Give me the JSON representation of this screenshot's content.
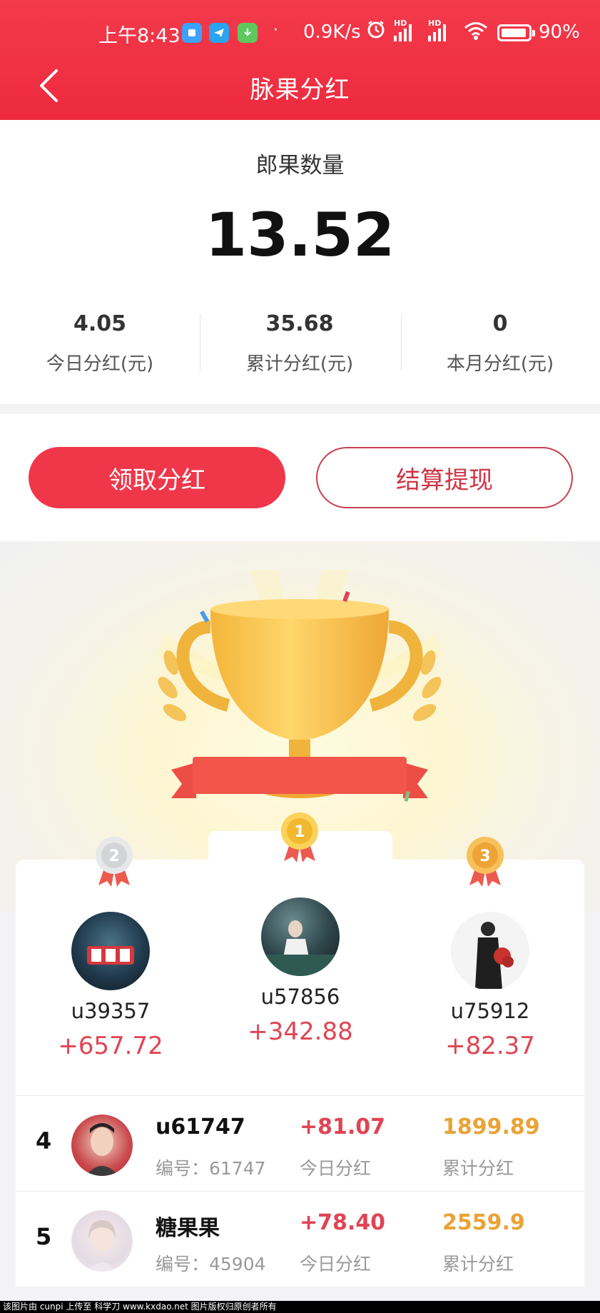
{
  "status_bar": {
    "time": "上午8:43",
    "dot": "·",
    "net_speed": "0.9K/s",
    "battery": "90%",
    "hd1": "HD",
    "hd2": "HD"
  },
  "header": {
    "title": "脉果分红",
    "back_icon": "chevron-left-icon"
  },
  "summary": {
    "label": "郎果数量",
    "value": "13.52",
    "stats": [
      {
        "value": "4.05",
        "label": "今日分红(元)"
      },
      {
        "value": "35.68",
        "label": "累计分红(元)"
      },
      {
        "value": "0",
        "label": "本月分红(元)"
      }
    ]
  },
  "actions": {
    "claim_label": "领取分红",
    "withdraw_label": "结算提现"
  },
  "podium": {
    "first": {
      "rank": "1",
      "name": "u57856",
      "amount": "+342.88"
    },
    "second": {
      "rank": "2",
      "name": "u39357",
      "amount": "+657.72"
    },
    "third": {
      "rank": "3",
      "name": "u75912",
      "amount": "+82.37"
    }
  },
  "ranking": [
    {
      "rank": "4",
      "name": "u61747",
      "id_text": "编号：61747",
      "today": "+81.07",
      "today_label": "今日分红",
      "total": "1899.89",
      "total_label": "累计分红"
    },
    {
      "rank": "5",
      "name": "糖果果",
      "id_text": "编号：45904",
      "today": "+78.40",
      "today_label": "今日分红",
      "total": "2559.9",
      "total_label": "累计分红"
    }
  ],
  "watermark": "该图片由 cunpi 上传至 科学刀 www.kxdao.net 图片版权归原创者所有",
  "colors": {
    "brand_red": "#ef3346",
    "amount_red": "#e04453",
    "total_orange": "#e9a336"
  }
}
